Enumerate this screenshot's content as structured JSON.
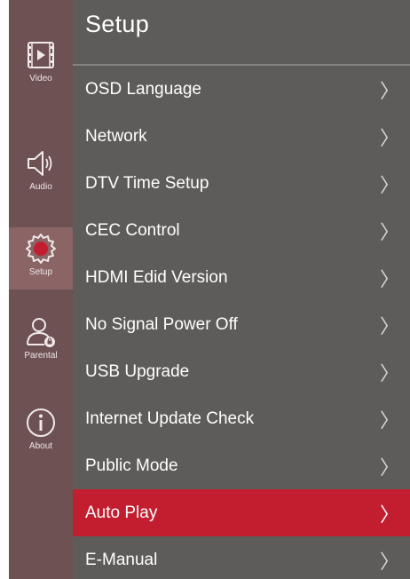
{
  "colors": {
    "sidebar_bg": "#6e5153",
    "sidebar_active_bg": "#8b6465",
    "panel_bg": "#5e5c5a",
    "selected_item_bg": "#c21e30",
    "text": "#ffffff"
  },
  "sidebar": {
    "items": [
      {
        "label": "Video",
        "icon": "video-icon",
        "active": false
      },
      {
        "label": "Audio",
        "icon": "speaker-icon",
        "active": false
      },
      {
        "label": "Setup",
        "icon": "gear-icon",
        "active": true
      },
      {
        "label": "Parental",
        "icon": "parental-lock-icon",
        "active": false
      },
      {
        "label": "About",
        "icon": "info-icon",
        "active": false
      }
    ]
  },
  "main": {
    "title": "Setup",
    "selected_index": 9,
    "items": [
      {
        "label": "OSD Language",
        "chevron": "〉"
      },
      {
        "label": "Network",
        "chevron": "〉"
      },
      {
        "label": "DTV Time Setup",
        "chevron": "〉"
      },
      {
        "label": "CEC Control",
        "chevron": "〉"
      },
      {
        "label": "HDMI Edid Version",
        "chevron": "〉"
      },
      {
        "label": "No Signal Power Off",
        "chevron": "〉"
      },
      {
        "label": "USB Upgrade",
        "chevron": "〉"
      },
      {
        "label": "Internet Update Check",
        "chevron": "〉"
      },
      {
        "label": "Public Mode",
        "chevron": "〉"
      },
      {
        "label": "Auto Play",
        "chevron": "〉"
      },
      {
        "label": "E-Manual",
        "chevron": "〉"
      }
    ]
  }
}
